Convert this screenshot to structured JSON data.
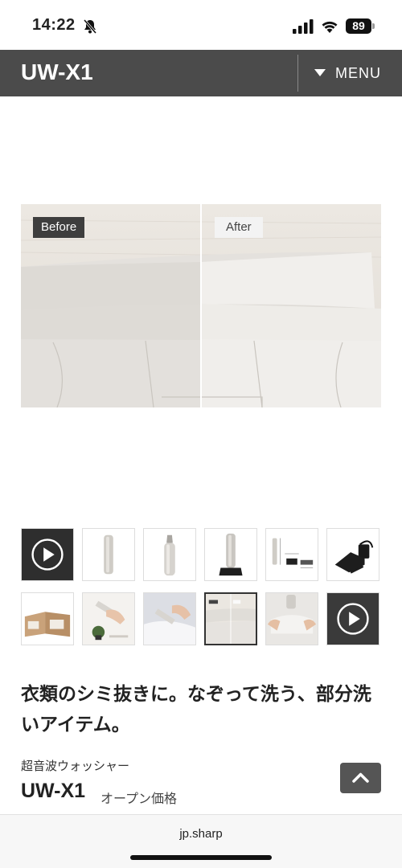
{
  "status_bar": {
    "time": "14:22",
    "battery": "89",
    "icons": [
      "bell-muted-icon",
      "signal-icon",
      "wifi-icon",
      "battery-icon"
    ]
  },
  "header": {
    "logo": "UW-X1",
    "menu_label": "MENU",
    "colors": {
      "background": "#4b4b4b",
      "text": "#ffffff"
    }
  },
  "hero": {
    "before_label": "Before",
    "after_label": "After"
  },
  "thumbnails": [
    {
      "name": "video-thumbnail",
      "icon": "play-icon",
      "selected": false
    },
    {
      "name": "product-front-thumbnail",
      "selected": false
    },
    {
      "name": "product-angle-thumbnail",
      "selected": false
    },
    {
      "name": "product-stand-thumbnail",
      "selected": false
    },
    {
      "name": "dimensions-thumbnail",
      "selected": false
    },
    {
      "name": "charger-thumbnail",
      "selected": false
    },
    {
      "name": "package-thumbnail",
      "selected": false
    },
    {
      "name": "usage-hand-thumbnail",
      "selected": false
    },
    {
      "name": "usage-shirt-thumbnail",
      "selected": false
    },
    {
      "name": "before-after-thumbnail",
      "selected": true
    },
    {
      "name": "cleaning-demo-thumbnail",
      "selected": false
    },
    {
      "name": "video-thumbnail-2",
      "icon": "play-icon",
      "selected": false
    }
  ],
  "product": {
    "headline": "衣類のシミ抜きに。なぞって洗う、部分洗いアイテム。",
    "category": "超音波ウォッシャー",
    "model": "UW-X1",
    "price": "オープン価格"
  },
  "browser": {
    "url": "jp.sharp"
  }
}
